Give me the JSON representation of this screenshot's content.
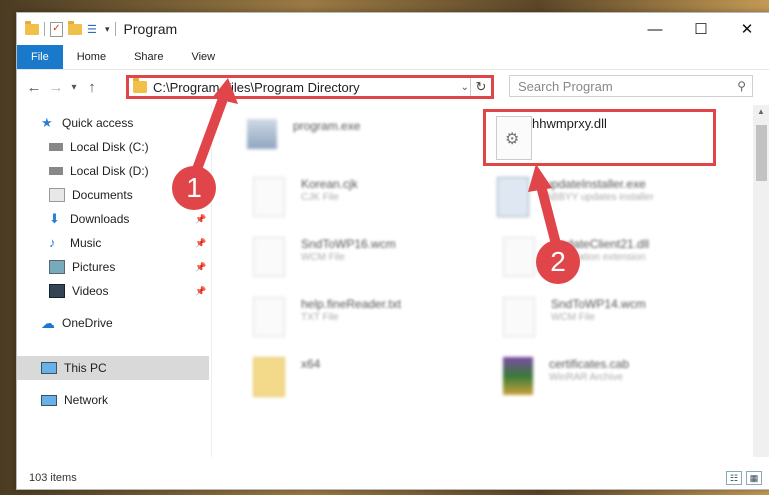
{
  "window": {
    "title": "Program",
    "controls": {
      "minimize": "—",
      "maximize": "☐",
      "close": "✕"
    }
  },
  "ribbon": {
    "tabs": [
      "File",
      "Home",
      "Share",
      "View"
    ]
  },
  "address": {
    "path": "C:\\Program Files\\Program Directory",
    "search_placeholder": "Search Program"
  },
  "nav": {
    "items": [
      {
        "label": "Quick access",
        "icon": "star-icon"
      },
      {
        "label": "Local Disk (C:)",
        "icon": "drive-icon"
      },
      {
        "label": "Local Disk (D:)",
        "icon": "drive-icon"
      },
      {
        "label": "Documents",
        "icon": "documents-icon"
      },
      {
        "label": "Downloads",
        "icon": "download-icon"
      },
      {
        "label": "Music",
        "icon": "music-icon"
      },
      {
        "label": "Pictures",
        "icon": "pictures-icon"
      },
      {
        "label": "Videos",
        "icon": "videos-icon"
      },
      {
        "label": "OneDrive",
        "icon": "cloud-icon"
      },
      {
        "label": "This PC",
        "icon": "computer-icon"
      },
      {
        "label": "Network",
        "icon": "network-icon"
      }
    ]
  },
  "files": {
    "left": [
      {
        "name": "program.exe",
        "type": ""
      },
      {
        "name": "Korean.cjk",
        "type": "CJK File"
      },
      {
        "name": "SndToWP16.wcm",
        "type": "WCM File"
      },
      {
        "name": "help.fineReader.txt",
        "type": "TXT File"
      },
      {
        "name": "x64",
        "type": ""
      }
    ],
    "right": [
      {
        "name": "hhwmprxy.dll",
        "type": ""
      },
      {
        "name": "updateInstaller.exe",
        "type": "ABBYY updates installer"
      },
      {
        "name": "UpdateClient21.dll",
        "type": "Application extension"
      },
      {
        "name": "SndToWP14.wcm",
        "type": "WCM File"
      },
      {
        "name": "certificates.cab",
        "type": "WinRAR Archive"
      }
    ]
  },
  "status": {
    "item_count": "103 items"
  },
  "callouts": {
    "one": "1",
    "two": "2"
  },
  "colors": {
    "accent": "#1979ca",
    "highlight": "#e0454a"
  }
}
